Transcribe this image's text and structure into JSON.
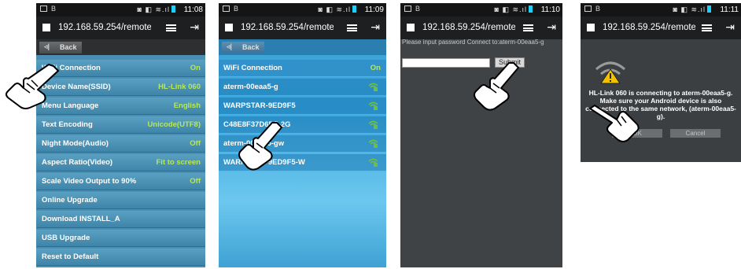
{
  "screens": [
    {
      "status_time": "11:08",
      "url": "192.168.59.254/remote/s",
      "back_label": "Back",
      "menu": [
        {
          "label": "WiFi Connection",
          "value": "On"
        },
        {
          "label": "Device Name(SSID)",
          "value": "HL-Link 060"
        },
        {
          "label": "Menu Language",
          "value": "English"
        },
        {
          "label": "Text Encoding",
          "value": "Unicode(UTF8)"
        },
        {
          "label": "Night Mode(Audio)",
          "value": "Off"
        },
        {
          "label": "Aspect Ratio(Video)",
          "value": "Fit to screen"
        },
        {
          "label": "Scale Video Output to 90%",
          "value": "Off"
        },
        {
          "label": "Online Upgrade",
          "value": ""
        },
        {
          "label": "Download INSTALL_A",
          "value": ""
        },
        {
          "label": "USB Upgrade",
          "value": ""
        },
        {
          "label": "Reset to Default",
          "value": ""
        }
      ]
    },
    {
      "status_time": "11:09",
      "url": "192.168.59.254/remote/s",
      "back_label": "Back",
      "header": {
        "label": "WiFi Connection",
        "value": "On"
      },
      "networks": [
        "aterm-00eaa5-g",
        "WARPSTAR-9ED9F5",
        "C48E8F37D6D5-2G",
        "aterm-00eaa5-gw",
        "WARPSTAR-9ED9F5-W"
      ]
    },
    {
      "status_time": "11:10",
      "url": "192.168.59.254/remote/\\",
      "prompt": "Please input password Connect to:aterm-00eaa5-g",
      "submit_label": "Submit"
    },
    {
      "status_time": "11:11",
      "url": "192.168.59.254/remote/\\",
      "message": "HL-Link 060 is connecting to aterm-00eaa5-g. Make sure your Android device is also connected to the same network, (aterm-00eaa5-g).",
      "ok_label": "OK",
      "cancel_label": "Cancel"
    }
  ],
  "colors": {
    "value_green": "#b6e85a",
    "menu_blue": "#4a8fb3",
    "battery_cyan": "#19d2ff"
  }
}
